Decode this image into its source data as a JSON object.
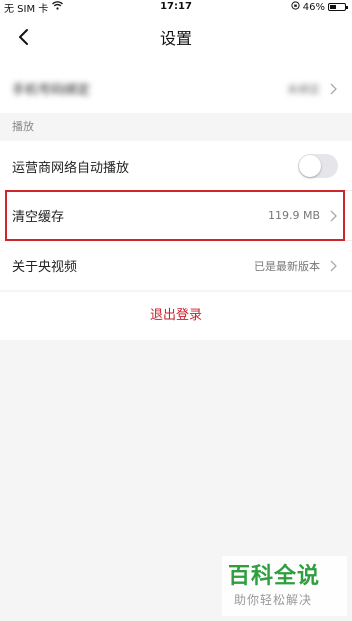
{
  "status_bar": {
    "carrier": "无 SIM 卡",
    "time": "17:17",
    "battery": "46%",
    "battery_level": 0.46
  },
  "nav": {
    "title": "设置"
  },
  "account_row": {
    "label": "手机号码绑定",
    "value": "未绑定"
  },
  "section": {
    "playback_header": "播放"
  },
  "rows": {
    "auto_play": {
      "label": "运营商网络自动播放",
      "enabled": false
    },
    "clear_cache": {
      "label": "清空缓存",
      "value": "119.9 MB"
    },
    "about": {
      "label": "关于央视频",
      "value": "已是最新版本"
    }
  },
  "logout": {
    "label": "退出登录"
  },
  "watermark": {
    "main": "百科全说",
    "sub": "助你轻松解决"
  },
  "colors": {
    "accent_red": "#c8232c",
    "highlight_border": "#d0262b",
    "watermark_green": "#2e9e3e"
  }
}
